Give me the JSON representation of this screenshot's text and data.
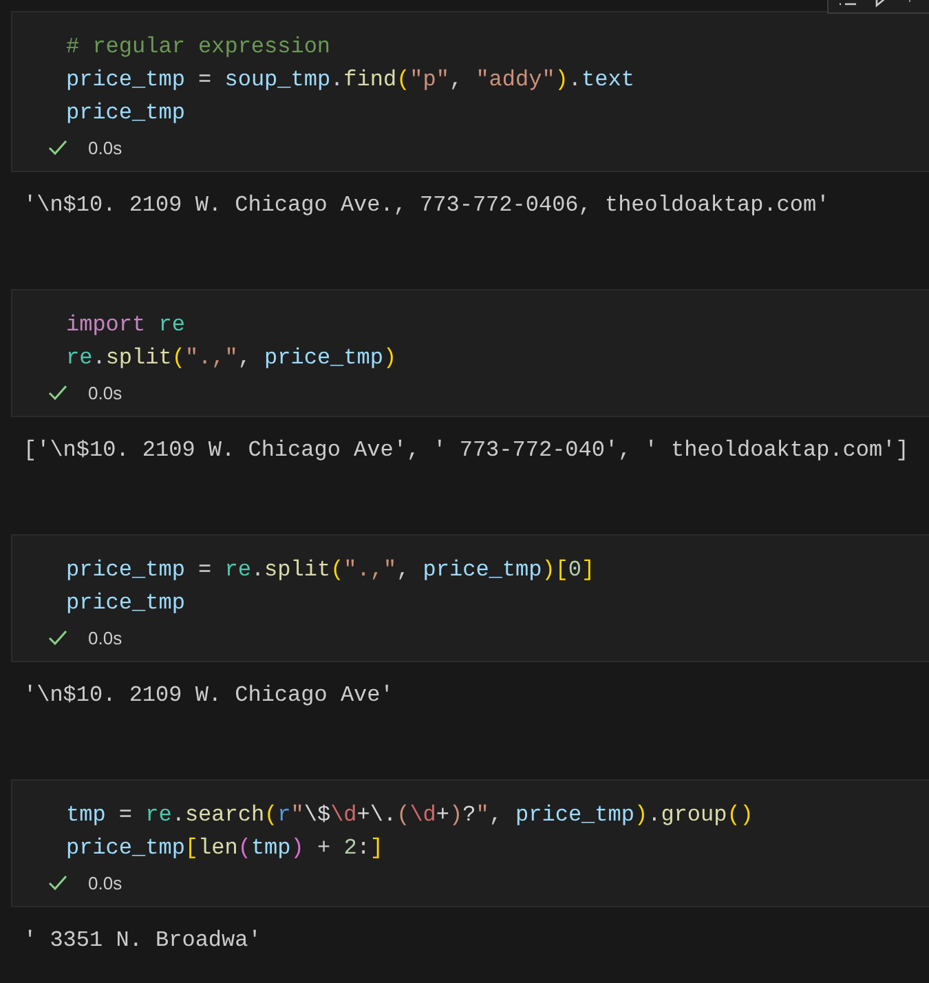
{
  "cells": [
    {
      "lines": [
        [
          {
            "t": "# regular expression",
            "kind": "comment"
          }
        ],
        [
          {
            "t": "price_tmp",
            "kind": "var"
          },
          {
            "t": " = ",
            "kind": "plain"
          },
          {
            "t": "soup_tmp",
            "kind": "var"
          },
          {
            "t": ".",
            "kind": "plain"
          },
          {
            "t": "find",
            "kind": "func"
          },
          {
            "t": "(",
            "kind": "p1"
          },
          {
            "t": "\"p\"",
            "kind": "str"
          },
          {
            "t": ", ",
            "kind": "plain"
          },
          {
            "t": "\"addy\"",
            "kind": "str"
          },
          {
            "t": ")",
            "kind": "p1"
          },
          {
            "t": ".",
            "kind": "plain"
          },
          {
            "t": "text",
            "kind": "var"
          }
        ],
        [
          {
            "t": "price_tmp",
            "kind": "var"
          }
        ]
      ],
      "succeeded": true,
      "time": "0.0s",
      "output": "'\\n$10. 2109 W. Chicago Ave., 773-772-0406, theoldoaktap.com'"
    },
    {
      "lines": [
        [
          {
            "t": "import ",
            "kind": "kw"
          },
          {
            "t": "re",
            "kind": "mod"
          }
        ],
        [
          {
            "t": "re",
            "kind": "mod"
          },
          {
            "t": ".",
            "kind": "plain"
          },
          {
            "t": "split",
            "kind": "func"
          },
          {
            "t": "(",
            "kind": "p1"
          },
          {
            "t": "\".,\"",
            "kind": "str"
          },
          {
            "t": ", ",
            "kind": "plain"
          },
          {
            "t": "price_tmp",
            "kind": "var"
          },
          {
            "t": ")",
            "kind": "p1"
          }
        ]
      ],
      "succeeded": true,
      "time": "0.0s",
      "output": "['\\n$10. 2109 W. Chicago Ave', ' 773-772-040', ' theoldoaktap.com']"
    },
    {
      "lines": [
        [
          {
            "t": "price_tmp",
            "kind": "var"
          },
          {
            "t": " = ",
            "kind": "plain"
          },
          {
            "t": "re",
            "kind": "mod"
          },
          {
            "t": ".",
            "kind": "plain"
          },
          {
            "t": "split",
            "kind": "func"
          },
          {
            "t": "(",
            "kind": "p1"
          },
          {
            "t": "\".,\"",
            "kind": "str"
          },
          {
            "t": ", ",
            "kind": "plain"
          },
          {
            "t": "price_tmp",
            "kind": "var"
          },
          {
            "t": ")",
            "kind": "p1"
          },
          {
            "t": "[",
            "kind": "p1"
          },
          {
            "t": "0",
            "kind": "num"
          },
          {
            "t": "]",
            "kind": "p1"
          }
        ],
        [
          {
            "t": "price_tmp",
            "kind": "var"
          }
        ]
      ],
      "succeeded": true,
      "time": "0.0s",
      "output": "'\\n$10. 2109 W. Chicago Ave'"
    },
    {
      "lines": [
        [
          {
            "t": "tmp",
            "kind": "var"
          },
          {
            "t": " = ",
            "kind": "plain"
          },
          {
            "t": "re",
            "kind": "mod"
          },
          {
            "t": ".",
            "kind": "plain"
          },
          {
            "t": "search",
            "kind": "func"
          },
          {
            "t": "(",
            "kind": "p1"
          },
          {
            "t": "r",
            "kind": "strprefix"
          },
          {
            "t": "\"",
            "kind": "str"
          },
          {
            "t": "\\$",
            "kind": "rxesc"
          },
          {
            "t": "\\d",
            "kind": "rxclass"
          },
          {
            "t": "+\\.",
            "kind": "rxesc"
          },
          {
            "t": "(",
            "kind": "rxgroup"
          },
          {
            "t": "\\d",
            "kind": "rxclass"
          },
          {
            "t": "+",
            "kind": "rxesc"
          },
          {
            "t": ")",
            "kind": "rxgroup"
          },
          {
            "t": "?",
            "kind": "rxesc"
          },
          {
            "t": "\"",
            "kind": "str"
          },
          {
            "t": ", ",
            "kind": "plain"
          },
          {
            "t": "price_tmp",
            "kind": "var"
          },
          {
            "t": ")",
            "kind": "p1"
          },
          {
            "t": ".",
            "kind": "plain"
          },
          {
            "t": "group",
            "kind": "func"
          },
          {
            "t": "()",
            "kind": "p1"
          }
        ],
        [
          {
            "t": "price_tmp",
            "kind": "var"
          },
          {
            "t": "[",
            "kind": "p1"
          },
          {
            "t": "len",
            "kind": "func"
          },
          {
            "t": "(",
            "kind": "p2"
          },
          {
            "t": "tmp",
            "kind": "var"
          },
          {
            "t": ")",
            "kind": "p2"
          },
          {
            "t": " + ",
            "kind": "plain"
          },
          {
            "t": "2",
            "kind": "num"
          },
          {
            "t": ":",
            "kind": "plain"
          },
          {
            "t": "]",
            "kind": "p1"
          }
        ]
      ],
      "succeeded": true,
      "time": "0.0s",
      "output": "' 3351 N. Broadwa'"
    }
  ]
}
